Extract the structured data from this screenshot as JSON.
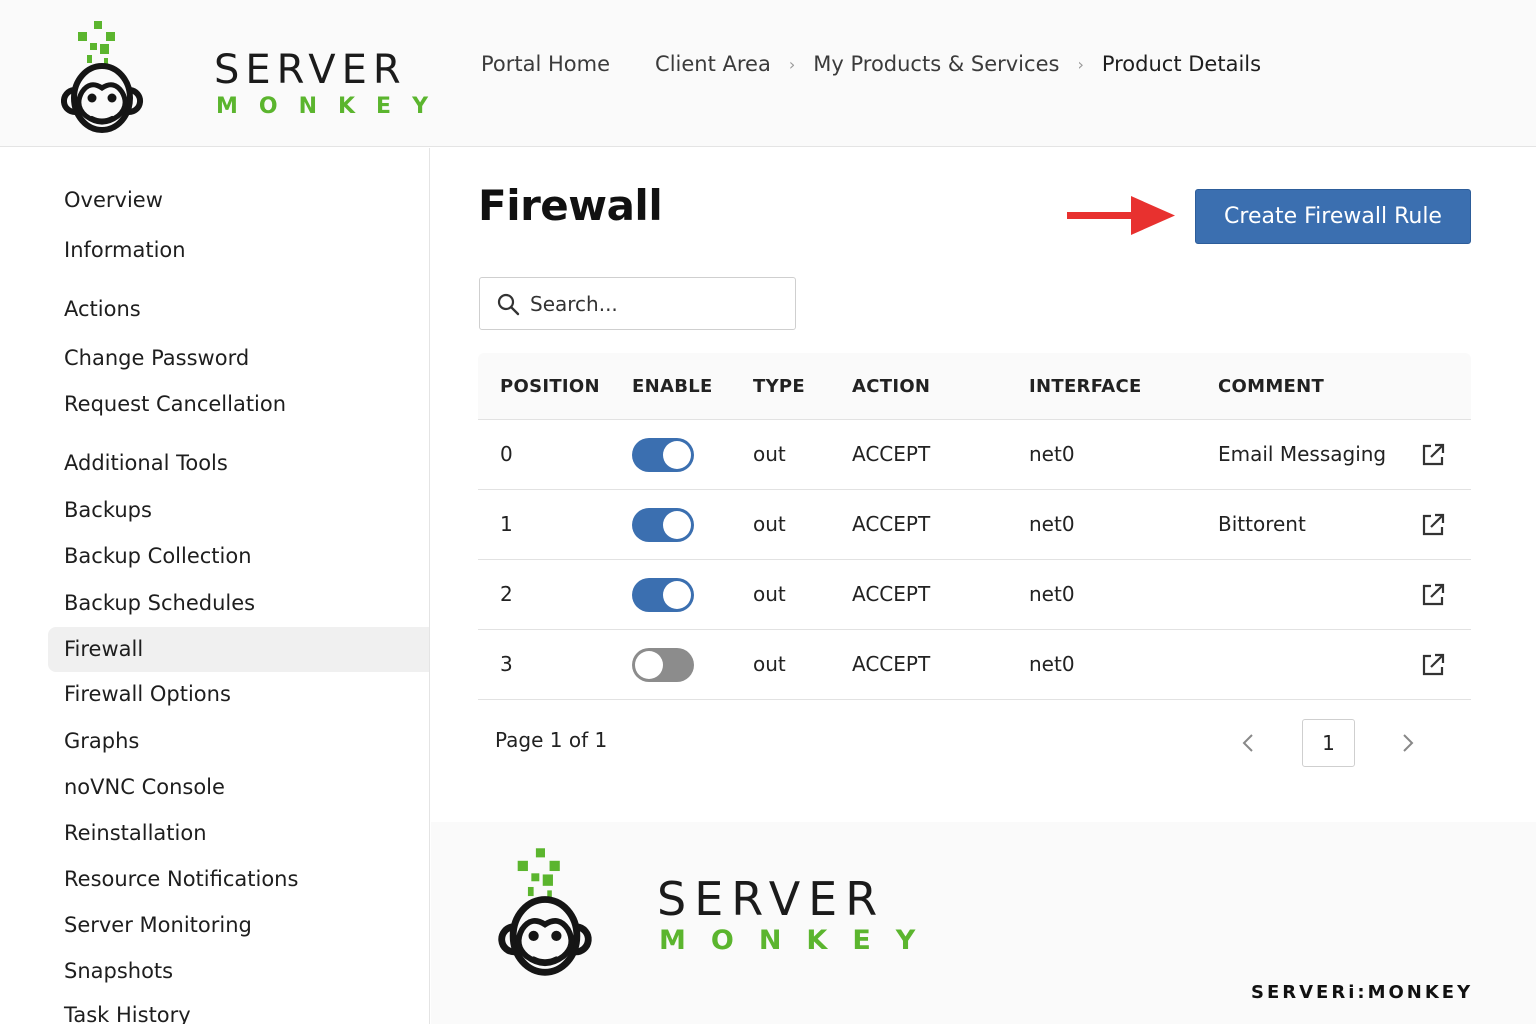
{
  "brand": {
    "word_top": "SERVER",
    "word_bottom": "MONKEY",
    "green": "#5bb52e",
    "footer_mark": "SERVERi:MONKEY"
  },
  "breadcrumbs": {
    "home": "Portal Home",
    "items": [
      "Client Area",
      "My Products & Services",
      "Product Details"
    ]
  },
  "sidebar": {
    "items": [
      {
        "label": "Overview"
      },
      {
        "label": "Information"
      },
      {
        "label": "Actions"
      },
      {
        "label": "Change Password"
      },
      {
        "label": "Request Cancellation"
      },
      {
        "label": "Additional Tools"
      },
      {
        "label": "Backups"
      },
      {
        "label": "Backup Collection"
      },
      {
        "label": "Backup Schedules"
      },
      {
        "label": "Firewall",
        "active": true
      },
      {
        "label": "Firewall Options"
      },
      {
        "label": "Graphs"
      },
      {
        "label": "noVNC Console"
      },
      {
        "label": "Reinstallation"
      },
      {
        "label": "Resource Notifications"
      },
      {
        "label": "Server Monitoring"
      },
      {
        "label": "Snapshots"
      },
      {
        "label": "Task History"
      }
    ]
  },
  "main": {
    "title": "Firewall",
    "create_button": "Create Firewall Rule",
    "button_color": "#3b6fb0",
    "arrow_color": "#e8312f",
    "search_placeholder": "Search..."
  },
  "table": {
    "headers": {
      "position": "POSITION",
      "enable": "ENABLE",
      "type": "TYPE",
      "action": "ACTION",
      "interface": "INTERFACE",
      "comment": "COMMENT"
    },
    "rows": [
      {
        "position": "0",
        "enabled": true,
        "type": "out",
        "action": "ACCEPT",
        "interface": "net0",
        "comment": "Email Messaging"
      },
      {
        "position": "1",
        "enabled": true,
        "type": "out",
        "action": "ACCEPT",
        "interface": "net0",
        "comment": "Bittorent"
      },
      {
        "position": "2",
        "enabled": true,
        "type": "out",
        "action": "ACCEPT",
        "interface": "net0",
        "comment": ""
      },
      {
        "position": "3",
        "enabled": false,
        "type": "out",
        "action": "ACCEPT",
        "interface": "net0",
        "comment": ""
      }
    ]
  },
  "pagination": {
    "summary": "Page 1 of 1",
    "current": "1"
  }
}
